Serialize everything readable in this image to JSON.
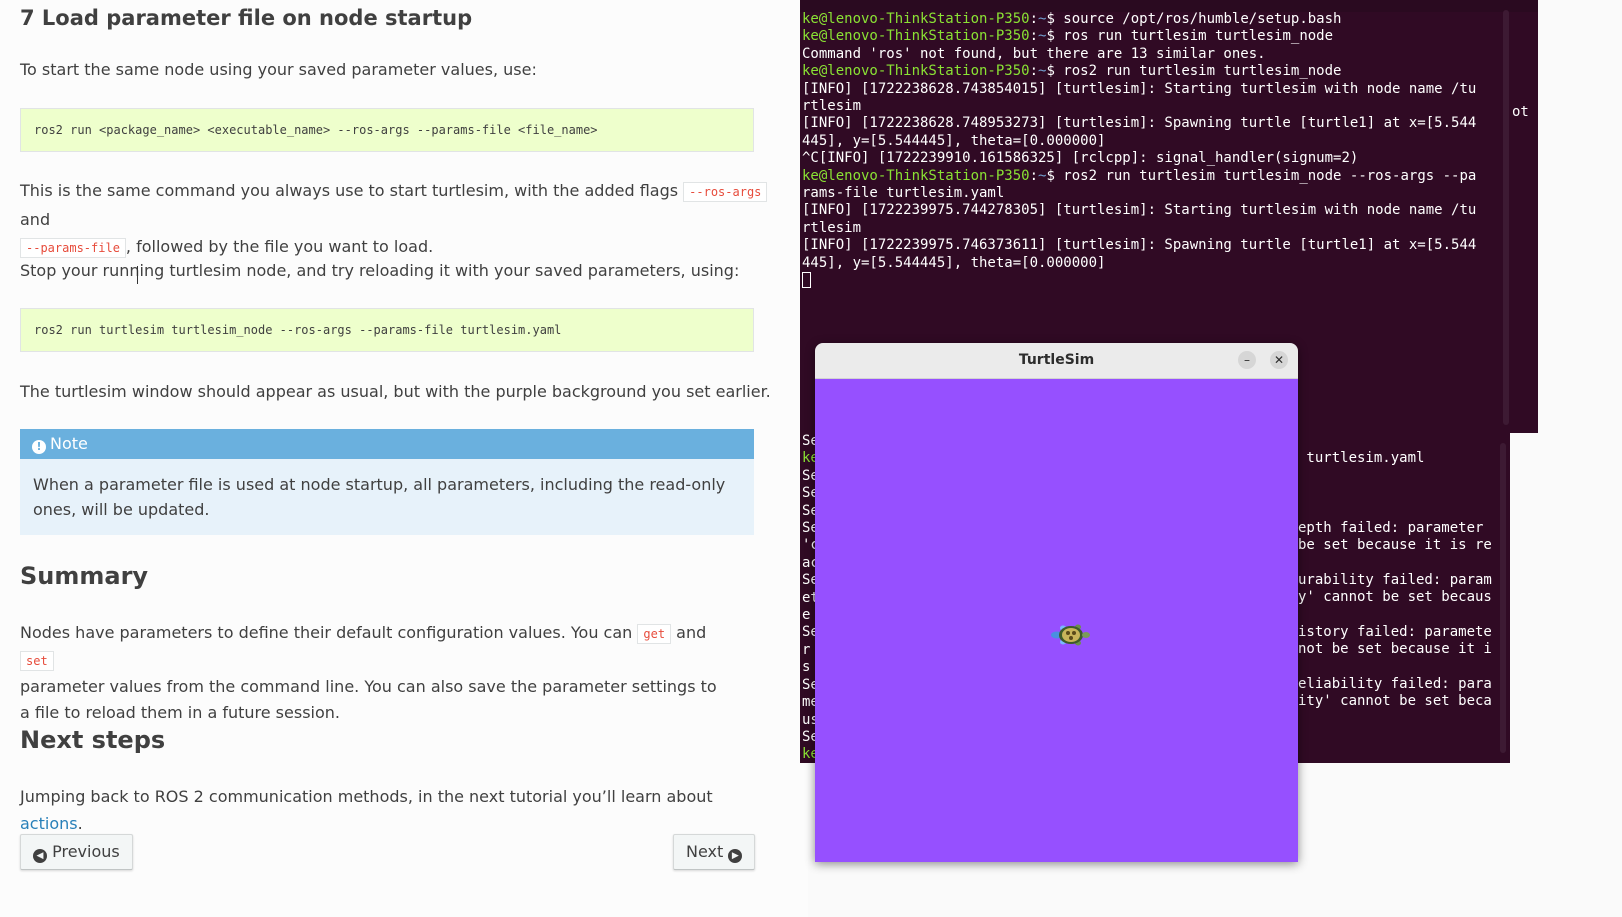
{
  "doc": {
    "heading": "7 Load parameter file on node startup",
    "intro": "To start the same node using your saved parameter values, use:",
    "code1": "ros2 run <package_name> <executable_name> --ros-args --params-file <file_name>",
    "p2_a": "This is the same command you always use to start turtlesim, with the added flags ",
    "p2_code1": "--ros-args",
    "p2_and": " and",
    "p2_code2": "--params-file",
    "p2_b": ", followed by the file you want to load.",
    "p3": "Stop your running turtlesim node, and try reloading it with your saved parameters, using:",
    "code2": "ros2 run turtlesim turtlesim_node --ros-args --params-file turtlesim.yaml",
    "p4": "The turtlesim window should appear as usual, but with the purple background you set earlier.",
    "note_title": "Note",
    "note_body": "When a parameter file is used at node startup, all parameters, including the read-only ones, will be updated.",
    "summary_heading": "Summary",
    "summary_a": "Nodes have parameters to define their default configuration values. You can ",
    "summary_get": "get",
    "summary_and": " and ",
    "summary_set": "set",
    "summary_b": "parameter values from the command line. You can also save the parameter settings to a file to reload them in a future session.",
    "next_heading": "Next steps",
    "next_a": "Jumping back to ROS 2 communication methods, in the next tutorial you’ll learn about ",
    "next_link": "actions",
    "next_end": ".",
    "prev_button": "Previous",
    "next_button": "Next"
  },
  "terminal_front": {
    "lines": [
      {
        "user": "ke@lenovo-ThinkStation-P350",
        "sep": ":",
        "path": "~",
        "cmd": "$ source /opt/ros/humble/setup.bash"
      },
      {
        "user": "ke@lenovo-ThinkStation-P350",
        "sep": ":",
        "path": "~",
        "cmd": "$ ros run turtlesim turtlesim_node"
      },
      {
        "text": "Command 'ros' not found, but there are 13 similar ones."
      },
      {
        "user": "ke@lenovo-ThinkStation-P350",
        "sep": ":",
        "path": "~",
        "cmd": "$ ros2 run turtlesim turtlesim_node"
      },
      {
        "text": "[INFO] [1722238628.743854015] [turtlesim]: Starting turtlesim with node name /tu"
      },
      {
        "text": "rtlesim"
      },
      {
        "text": "[INFO] [1722238628.748953273] [turtlesim]: Spawning turtle [turtle1] at x=[5.544"
      },
      {
        "text": "445], y=[5.544445], theta=[0.000000]"
      },
      {
        "text": "^C[INFO] [1722239910.161586325] [rclcpp]: signal_handler(signum=2)"
      },
      {
        "user": "ke@lenovo-ThinkStation-P350",
        "sep": ":",
        "path": "~",
        "cmd": "$ ros2 run turtlesim turtlesim_node --ros-args --pa"
      },
      {
        "text": "rams-file turtlesim.yaml"
      },
      {
        "text": "[INFO] [1722239975.744278305] [turtlesim]: Starting turtlesim with node name /tu"
      },
      {
        "text": "rtlesim"
      },
      {
        "text": "[INFO] [1722239975.746373611] [turtlesim]: Spawning turtle [turtle1] at x=[5.544"
      },
      {
        "text": "445], y=[5.544445], theta=[0.000000]"
      }
    ],
    "right_fragment": "ot"
  },
  "terminal_back": {
    "left_column": [
      "Se",
      "ke",
      "Se",
      "Se",
      "Se",
      "Se",
      "'c",
      "ac",
      "Se",
      "et",
      "e",
      "Se",
      "r",
      "s",
      "Se",
      "me",
      "us",
      "Se",
      "ke"
    ],
    "right_lines": [
      " turtlesim.yaml",
      "",
      "",
      "",
      "epth failed: parameter",
      "be set because it is re",
      "",
      "urability failed: param",
      "y' cannot be set becaus",
      "",
      "istory failed: paramete",
      "not be set because it i",
      "",
      "eliability failed: para",
      "ity' cannot be set beca"
    ]
  },
  "turtlesim": {
    "title": "TurtleSim",
    "minimize": "–",
    "close": "✕",
    "background": "#9650ff"
  }
}
